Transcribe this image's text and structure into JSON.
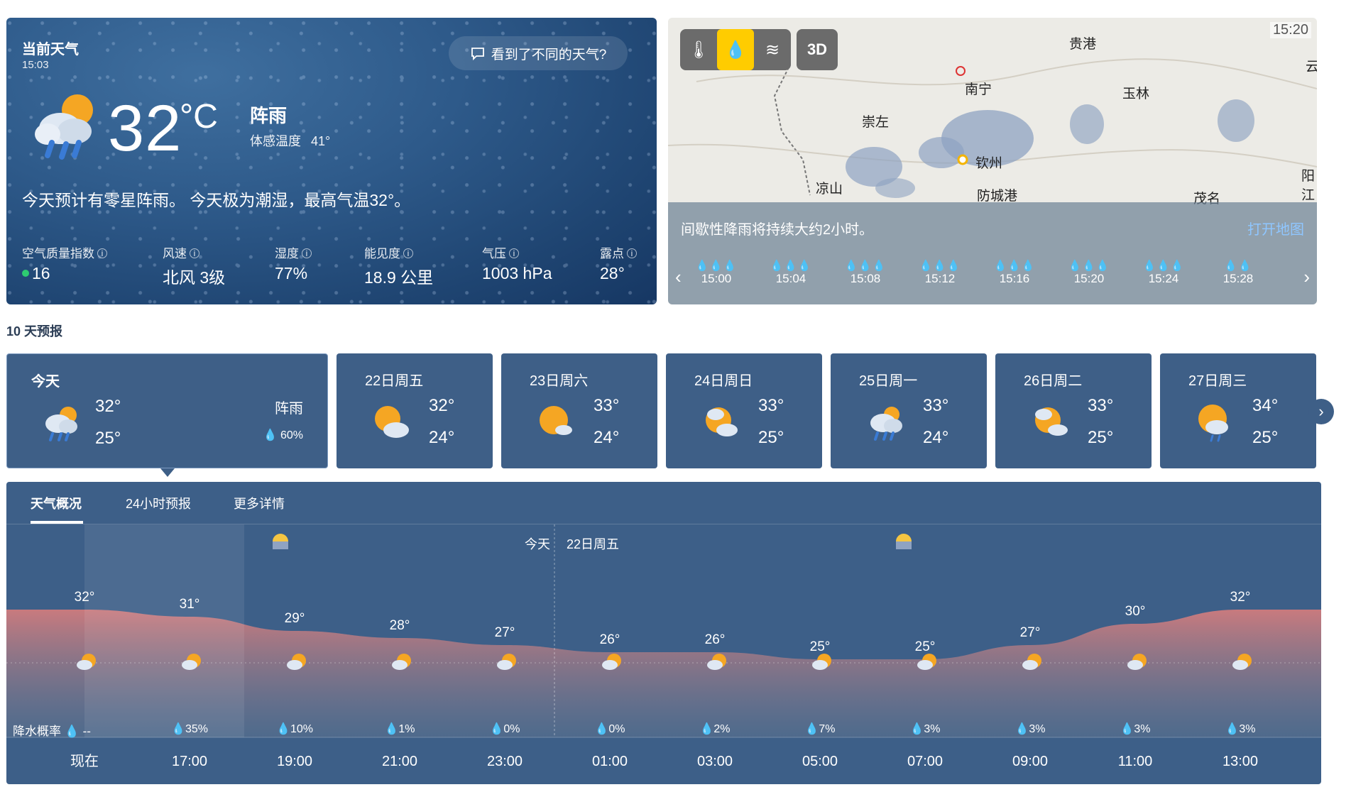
{
  "current": {
    "title": "当前天气",
    "time": "15:03",
    "feedback": "看到了不同的天气?",
    "temp": "32",
    "unit": "°C",
    "condition": "阵雨",
    "feels_label": "体感温度",
    "feels_value": "41°",
    "summary": "今天预计有零星阵雨。 今天极为潮湿，最高气温32°。",
    "metrics": [
      {
        "label": "空气质量指数",
        "value": "16"
      },
      {
        "label": "风速",
        "value": "北风 3级"
      },
      {
        "label": "湿度",
        "value": "77%"
      },
      {
        "label": "能见度",
        "value": "18.9 公里"
      },
      {
        "label": "气压",
        "value": "1003 hPa"
      },
      {
        "label": "露点",
        "value": "28°"
      }
    ],
    "colors": {
      "aqi_good": "#2ecc71"
    }
  },
  "map": {
    "time": "15:20",
    "tool_3d": "3D",
    "cities": [
      "贵港",
      "南宁",
      "玉林",
      "崇左",
      "钦州",
      "凉山",
      "防城港",
      "茂名",
      "阳江",
      "云"
    ],
    "message": "间歇性降雨将持续大约2小时。",
    "open_label": "打开地图",
    "timeline": [
      {
        "time": "15:00",
        "drops": "💧💧💧"
      },
      {
        "time": "15:04",
        "drops": "💧💧💧"
      },
      {
        "time": "15:08",
        "drops": "💧💧💧"
      },
      {
        "time": "15:12",
        "drops": "💧💧💧"
      },
      {
        "time": "15:16",
        "drops": "💧💧💧"
      },
      {
        "time": "15:20",
        "drops": "💧💧💧"
      },
      {
        "time": "15:24",
        "drops": "💧💧💧"
      },
      {
        "time": "15:28",
        "drops": "💧💧"
      }
    ]
  },
  "forecast": {
    "label": "10 天预报",
    "today": {
      "name": "今天",
      "hi": "32°",
      "lo": "25°",
      "condition": "阵雨",
      "pop": "60%"
    },
    "days": [
      {
        "name": "22日周五",
        "hi": "32°",
        "lo": "24°",
        "icon": "sun-cloud"
      },
      {
        "name": "23日周六",
        "hi": "33°",
        "lo": "24°",
        "icon": "sun-small-cloud"
      },
      {
        "name": "24日周日",
        "hi": "33°",
        "lo": "25°",
        "icon": "sun-cloud"
      },
      {
        "name": "25日周一",
        "hi": "33°",
        "lo": "24°",
        "icon": "cloud-rain"
      },
      {
        "name": "26日周二",
        "hi": "33°",
        "lo": "25°",
        "icon": "sun-cloud"
      },
      {
        "name": "27日周三",
        "hi": "34°",
        "lo": "25°",
        "icon": "sun-cloud-rain"
      }
    ]
  },
  "detail": {
    "tabs": [
      "天气概况",
      "24小时预报",
      "更多详情"
    ],
    "today_label": "今天",
    "next_day_label": "22日周五",
    "pop_label": "降水概率",
    "pop_first": "--",
    "colors": {
      "temp_top": "#c97a7e",
      "temp_bottom": "#6f7f95"
    }
  },
  "chart_data": {
    "type": "area",
    "x": [
      "现在",
      "17:00",
      "19:00",
      "21:00",
      "23:00",
      "01:00",
      "03:00",
      "05:00",
      "07:00",
      "09:00",
      "11:00",
      "13:00"
    ],
    "temps": [
      32,
      31,
      29,
      28,
      27,
      26,
      26,
      25,
      25,
      27,
      30,
      32
    ],
    "temp_labels": [
      "32°",
      "31°",
      "29°",
      "28°",
      "27°",
      "26°",
      "26°",
      "25°",
      "25°",
      "27°",
      "30°",
      "32°"
    ],
    "pop": [
      "35%",
      "10%",
      "1%",
      "0%",
      "0%",
      "2%",
      "7%",
      "3%",
      "3%",
      "3%",
      "3%"
    ],
    "ylim": [
      20,
      34
    ]
  }
}
